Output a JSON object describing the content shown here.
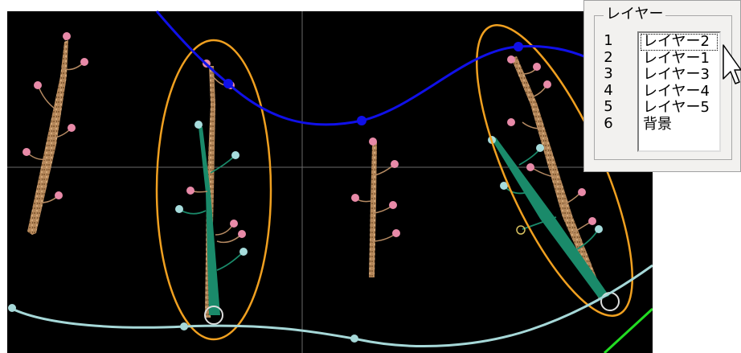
{
  "layer_panel": {
    "title": "レイヤー",
    "numbers": [
      "1",
      "2",
      "3",
      "4",
      "5",
      "6"
    ],
    "items": [
      {
        "label": "レイヤー2",
        "selected": true
      },
      {
        "label": "レイヤー1",
        "selected": false
      },
      {
        "label": "レイヤー3",
        "selected": false
      },
      {
        "label": "レイヤー4",
        "selected": false
      },
      {
        "label": "レイヤー5",
        "selected": false
      },
      {
        "label": "背景",
        "selected": false
      }
    ]
  },
  "colors": {
    "canvas_bg": "#000000",
    "blue_curve": "#1010e8",
    "cyan_curve": "#a6d8d8",
    "green_curve": "#22dd22",
    "ellipse": "#f0a020",
    "green_stroke": "#1a8a6a",
    "branch_brown": "#b58a62",
    "pink_bud": "#e88aa8",
    "cyan_bud": "#a6dcdc",
    "crosshair": "#707070"
  }
}
